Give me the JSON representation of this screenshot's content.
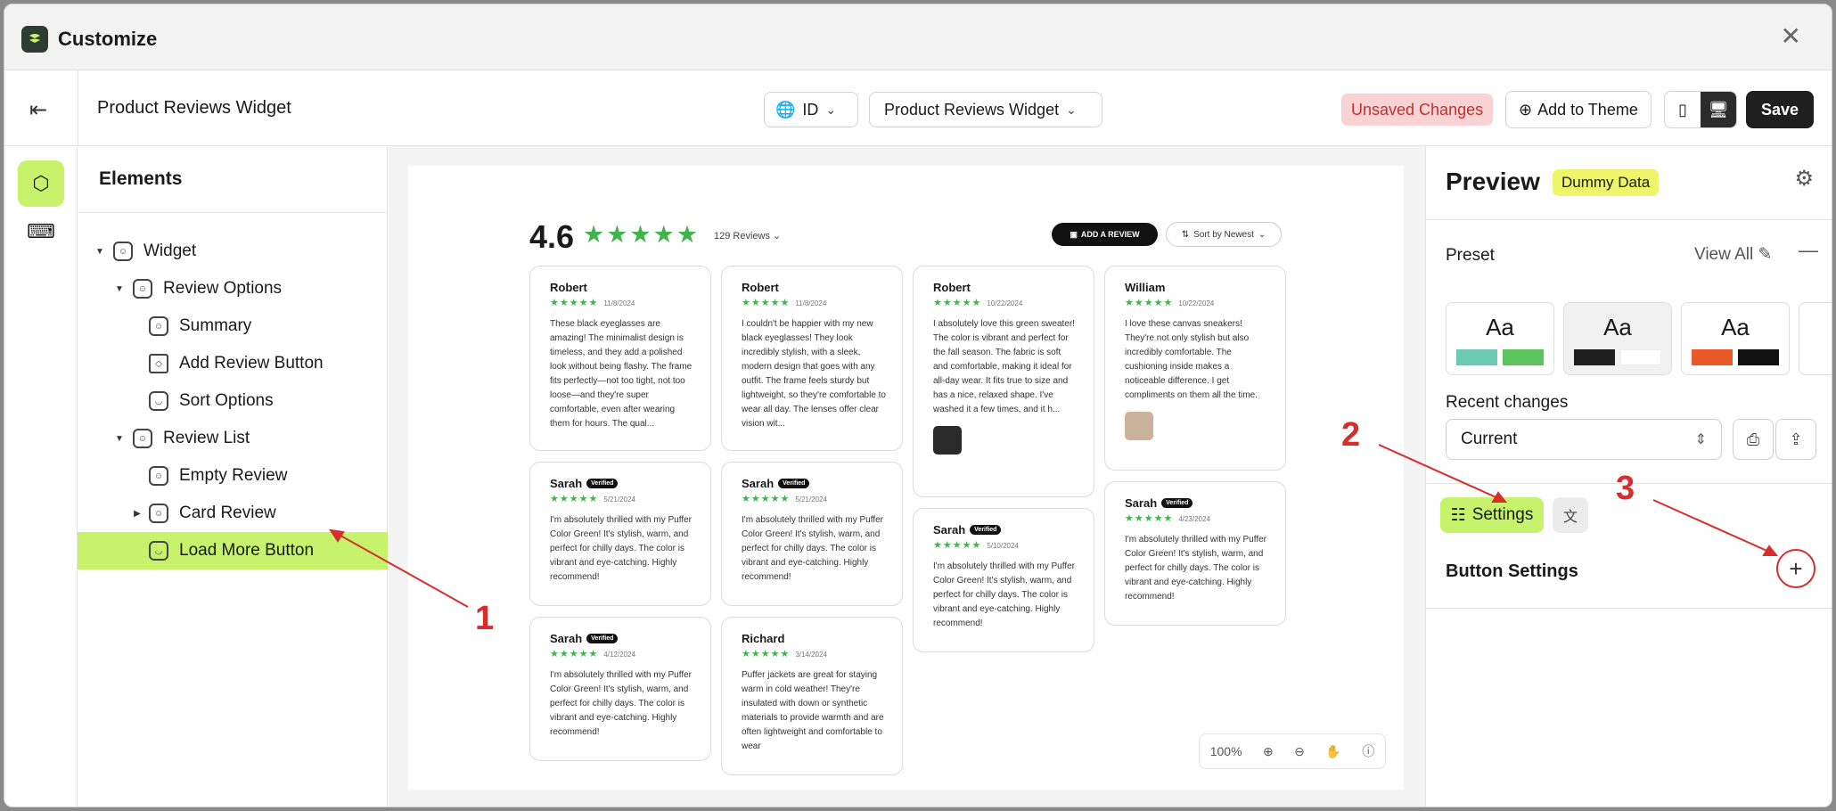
{
  "window": {
    "title": "Customize"
  },
  "toolbar": {
    "page_name": "Product Reviews Widget",
    "locale": "ID",
    "widget_select": "Product Reviews Widget",
    "unsaved": "Unsaved Changes",
    "add_to_theme": "Add to Theme",
    "save": "Save"
  },
  "elements": {
    "title": "Elements",
    "tree": [
      {
        "label": "Widget"
      },
      {
        "label": "Review Options"
      },
      {
        "label": "Summary"
      },
      {
        "label": "Add Review Button"
      },
      {
        "label": "Sort Options"
      },
      {
        "label": "Review List"
      },
      {
        "label": "Empty Review"
      },
      {
        "label": "Card Review"
      },
      {
        "label": "Load More Button"
      }
    ]
  },
  "canvas": {
    "rating": "4.6",
    "stars": "★★★★★",
    "review_count": "129 Reviews",
    "add_review": "ADD A REVIEW",
    "sort": "Sort by Newest",
    "zoom": "100%",
    "cards": [
      {
        "name": "Robert",
        "verified": "",
        "stars": "★★★★★",
        "date": "11/8/2024",
        "text": "These black eyeglasses are amazing! The minimalist design is timeless, and they add a polished look without being flashy. The frame fits perfectly—not too tight, not too loose—and they're super comfortable, even after wearing them for hours. The qual..."
      },
      {
        "name": "Robert",
        "verified": "",
        "stars": "★★★★★",
        "date": "11/8/2024",
        "text": "I couldn't be happier with my new black eyeglasses! They look incredibly stylish, with a sleek, modern design that goes with any outfit. The frame feels sturdy but lightweight, so they're comfortable to wear all day. The lenses offer clear vision wit..."
      },
      {
        "name": "Robert",
        "verified": "",
        "stars": "★★★★★",
        "date": "10/22/2024",
        "text": "I absolutely love this green sweater! The color is vibrant and perfect for the fall season. The fabric is soft and comfortable, making it ideal for all-day wear. It fits true to size and has a nice, relaxed shape. I've washed it a few times, and it h..."
      },
      {
        "name": "William",
        "verified": "",
        "stars": "★★★★★",
        "date": "10/22/2024",
        "text": "I love these canvas sneakers! They're not only stylish but also incredibly comfortable. The cushioning inside makes a noticeable difference. I get compliments on them all the time."
      },
      {
        "name": "Sarah",
        "verified": "Verified",
        "stars": "★★★★★",
        "date": "5/21/2024",
        "text": "I'm absolutely thrilled with my Puffer Color Green! It's stylish, warm, and perfect for chilly days. The color is vibrant and eye-catching. Highly recommend!"
      },
      {
        "name": "Sarah",
        "verified": "Verified",
        "stars": "★★★★★",
        "date": "5/21/2024",
        "text": "I'm absolutely thrilled with my Puffer Color Green! It's stylish, warm, and perfect for chilly days. The color is vibrant and eye-catching. Highly recommend!"
      },
      {
        "name": "Sarah",
        "verified": "Verified",
        "stars": "★★★★★",
        "date": "5/10/2024",
        "text": "I'm absolutely thrilled with my Puffer Color Green! It's stylish, warm, and perfect for chilly days. The color is vibrant and eye-catching. Highly recommend!"
      },
      {
        "name": "Sarah",
        "verified": "Verified",
        "stars": "★★★★★",
        "date": "4/23/2024",
        "text": "I'm absolutely thrilled with my Puffer Color Green! It's stylish, warm, and perfect for chilly days. The color is vibrant and eye-catching. Highly recommend!"
      },
      {
        "name": "Sarah",
        "verified": "Verified",
        "stars": "★★★★★",
        "date": "4/12/2024",
        "text": "I'm absolutely thrilled with my Puffer Color Green! It's stylish, warm, and perfect for chilly days. The color is vibrant and eye-catching. Highly recommend!"
      },
      {
        "name": "Richard",
        "verified": "",
        "stars": "★★★★★",
        "date": "3/14/2024",
        "text": "Puffer jackets are great for staying warm in cold weather! They're insulated with down or synthetic materials to provide warmth and are often lightweight and comfortable to wear"
      }
    ]
  },
  "preview": {
    "title": "Preview",
    "badge": "Dummy Data",
    "preset_label": "Preset",
    "view_all": "View All",
    "preset_sample": "Aa",
    "recent_label": "Recent changes",
    "recent_value": "Current",
    "settings_tab": "Settings",
    "section": "Button Settings"
  },
  "colors": {
    "accent": "#c6f36b",
    "star": "#3fb44b",
    "annotation": "#d62d2d",
    "preset1a": "#6cc9b4",
    "preset1b": "#5cc45c",
    "preset2a": "#1f1f1f",
    "preset2b": "#ffffff",
    "preset3a": "#e85a2a",
    "preset3b": "#111111"
  },
  "annotations": [
    "1",
    "2",
    "3"
  ]
}
